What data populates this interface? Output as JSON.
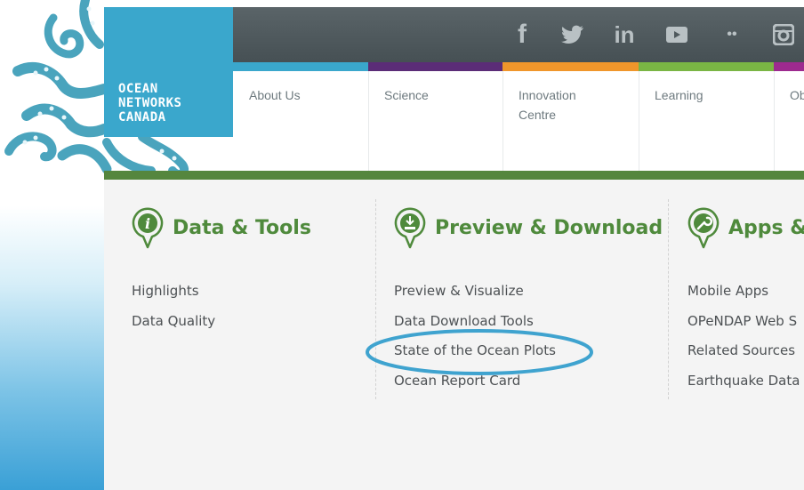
{
  "brand": {
    "logo_text": "OCEAN\nNETWORKS\nCANADA",
    "color": "#3aa7cc"
  },
  "social": [
    {
      "icon": "facebook-icon",
      "glyph": "f"
    },
    {
      "icon": "twitter-icon",
      "glyph": "🐦"
    },
    {
      "icon": "linkedin-icon",
      "glyph": "in"
    },
    {
      "icon": "youtube-icon",
      "glyph": "▶"
    },
    {
      "icon": "flickr-icon",
      "glyph": "••"
    },
    {
      "icon": "instagram-icon",
      "glyph": "◎"
    }
  ],
  "nav": {
    "items": [
      {
        "label": "About Us",
        "color": "#3aa7cc"
      },
      {
        "label": "Science",
        "color": "#5b2c77"
      },
      {
        "label": "Innovation\nCentre",
        "color": "#f0962b"
      },
      {
        "label": "Learning",
        "color": "#7ab544"
      },
      {
        "label": "Ob",
        "color": "#9d2a8f"
      }
    ]
  },
  "menu": {
    "columns": [
      {
        "title": "Data & Tools",
        "icon": "info-icon",
        "links": [
          "Highlights",
          "Data Quality"
        ]
      },
      {
        "title": "Preview & Download",
        "icon": "download-icon",
        "links": [
          "Preview & Visualize",
          "Data Download Tools",
          "State of the Ocean Plots",
          "Ocean Report Card"
        ]
      },
      {
        "title": "Apps &",
        "icon": "wrench-icon",
        "links": [
          "Mobile Apps",
          "OPeNDAP Web S",
          "Related Sources",
          "Earthquake Data"
        ]
      }
    ]
  },
  "colors": {
    "accent_green": "#55863e",
    "title_green": "#4f8a3c",
    "highlight_ellipse": "#3fa3cf"
  }
}
